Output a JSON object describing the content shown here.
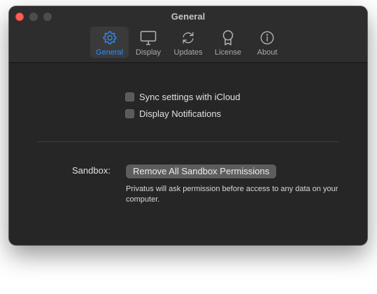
{
  "window": {
    "title": "General"
  },
  "toolbar": {
    "items": [
      {
        "label": "General",
        "icon": "gear-icon",
        "selected": true
      },
      {
        "label": "Display",
        "icon": "display-icon",
        "selected": false
      },
      {
        "label": "Updates",
        "icon": "sync-arrows-icon",
        "selected": false
      },
      {
        "label": "License",
        "icon": "badge-ribbon-icon",
        "selected": false
      },
      {
        "label": "About",
        "icon": "info-circle-icon",
        "selected": false
      }
    ]
  },
  "settings": {
    "sync_icloud": {
      "label": "Sync settings with iCloud",
      "checked": false
    },
    "display_notifications": {
      "label": "Display Notifications",
      "checked": false
    }
  },
  "sandbox": {
    "label": "Sandbox:",
    "button_label": "Remove All Sandbox Permissions",
    "help_text": "Privatus will ask permission before access to any data on your computer."
  },
  "colors": {
    "accent": "#2f8cf0",
    "window_bg": "#262626",
    "close": "#ff5f57"
  }
}
